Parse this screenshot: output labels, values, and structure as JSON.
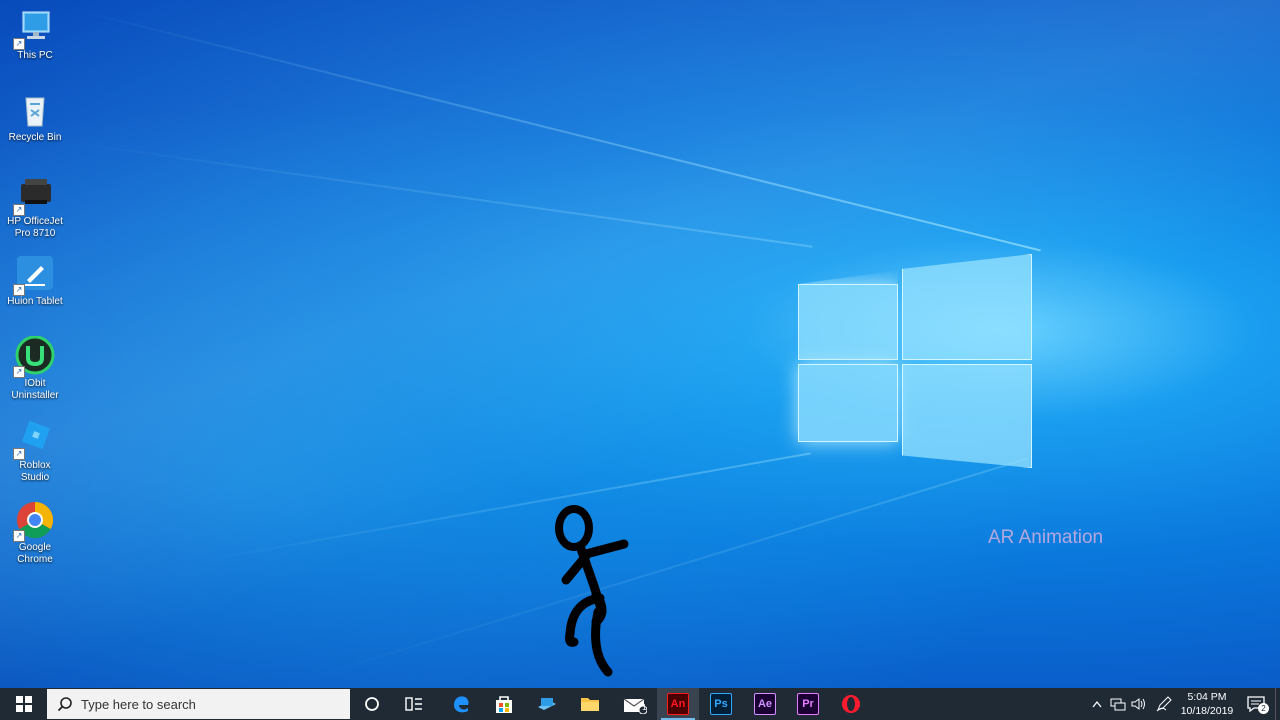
{
  "desktop_icons": [
    {
      "label": "This PC",
      "icon": "computer-icon"
    },
    {
      "label": "Recycle Bin",
      "icon": "recycle-bin-icon"
    },
    {
      "label": "HP OfficeJet Pro 8710",
      "icon": "printer-icon"
    },
    {
      "label": "Huion Tablet",
      "icon": "tablet-pen-icon"
    },
    {
      "label": "IObit Uninstaller",
      "icon": "iobit-uninstaller-icon"
    },
    {
      "label": "Roblox Studio",
      "icon": "roblox-studio-icon"
    },
    {
      "label": "Google Chrome",
      "icon": "chrome-icon"
    }
  ],
  "watermark": "AR Animation",
  "taskbar": {
    "search_placeholder": "Type here to search",
    "pinned_apps": [
      {
        "name": "cortana",
        "icon": "cortana-icon"
      },
      {
        "name": "task-view",
        "icon": "task-view-icon"
      },
      {
        "name": "edge",
        "icon": "edge-icon"
      },
      {
        "name": "microsoft-store",
        "icon": "store-icon"
      },
      {
        "name": "this-pc",
        "icon": "computer-icon"
      },
      {
        "name": "file-explorer",
        "icon": "folder-icon"
      },
      {
        "name": "mail",
        "icon": "mail-icon",
        "badge": "1"
      },
      {
        "name": "animate",
        "icon": "animate-icon",
        "text": "An",
        "color": "#ff1a1a",
        "active": true
      },
      {
        "name": "photoshop",
        "icon": "photoshop-icon",
        "text": "Ps",
        "color": "#31a8ff"
      },
      {
        "name": "after-effects",
        "icon": "after-effects-icon",
        "text": "Ae",
        "color": "#d291ff"
      },
      {
        "name": "premiere",
        "icon": "premiere-icon",
        "text": "Pr",
        "color": "#e77cff"
      },
      {
        "name": "opera",
        "icon": "opera-icon"
      }
    ],
    "clock": {
      "time": "5:04 PM",
      "date": "10/18/2019"
    },
    "notification_count": "2"
  },
  "colors": {
    "taskbar": "#1f2a35",
    "accent": "#76b9ed"
  }
}
